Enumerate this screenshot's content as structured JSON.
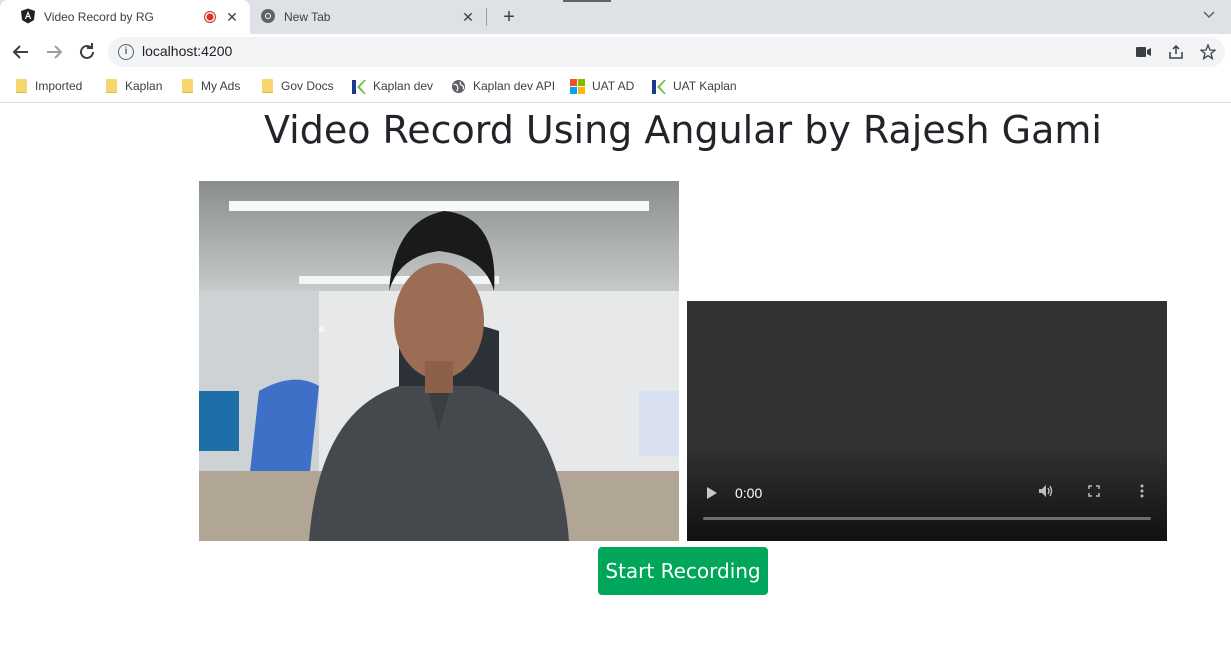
{
  "browser": {
    "tabs": [
      {
        "title": "Video Record by RG",
        "active": true,
        "recording": true,
        "icon": "angular-icon"
      },
      {
        "title": "New Tab",
        "active": false,
        "icon": "chrome-icon"
      }
    ],
    "new_tab_symbol": "+",
    "close_symbol": "✕",
    "address": "localhost:4200",
    "bookmarks": [
      {
        "label": "Imported",
        "icon": "folder-icon"
      },
      {
        "label": "Kaplan",
        "icon": "folder-icon"
      },
      {
        "label": "My Ads",
        "icon": "folder-icon"
      },
      {
        "label": "Gov Docs",
        "icon": "folder-icon"
      },
      {
        "label": "Kaplan dev",
        "icon": "kaplan-icon"
      },
      {
        "label": "Kaplan dev API",
        "icon": "globe-icon"
      },
      {
        "label": "UAT AD",
        "icon": "microsoft-icon"
      },
      {
        "label": "UAT Kaplan",
        "icon": "kaplan-icon"
      }
    ]
  },
  "page": {
    "title": "Video Record Using Angular by Rajesh Gami",
    "player_time": "0:00",
    "start_button": "Start Recording"
  },
  "colors": {
    "button_green": "#00a65a",
    "recording_red": "#d93025",
    "tabstrip": "#dee1e6"
  }
}
